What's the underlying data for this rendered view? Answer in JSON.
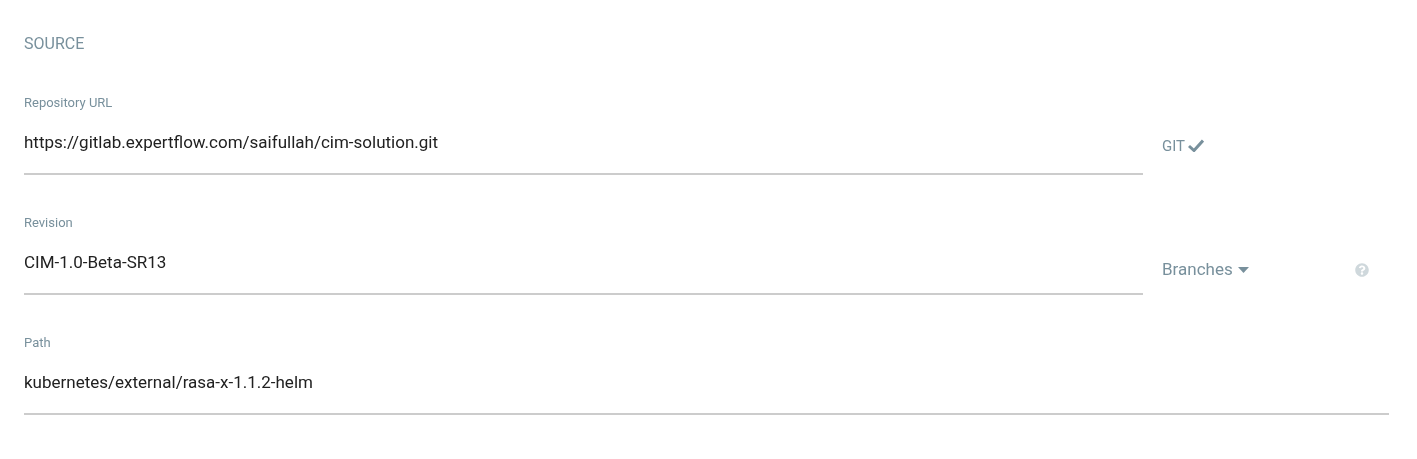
{
  "section_title": "SOURCE",
  "fields": [
    {
      "label": "Repository URL",
      "value": "https://gitlab.expertflow.com/saifullah/cim-solution.git",
      "addon": {
        "kind": "badge",
        "label": "GIT"
      }
    },
    {
      "label": "Revision",
      "value": "CIM-1.0-Beta-SR13",
      "addon": {
        "kind": "dropdown",
        "label": "Branches"
      }
    },
    {
      "label": "Path",
      "value": "kubernetes/external/rasa-x-1.1.2-helm"
    }
  ]
}
